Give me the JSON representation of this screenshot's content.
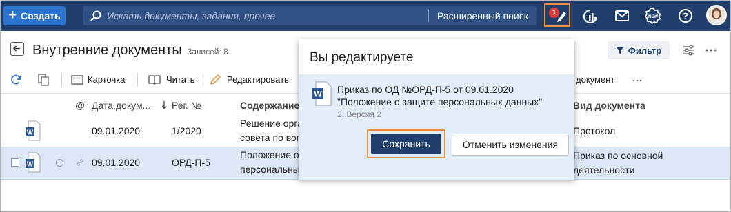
{
  "topbar": {
    "create_label": "Создать",
    "search_placeholder": "Искать документы, задания, прочее",
    "advanced_search": "Расширенный поиск",
    "edit_badge": "1",
    "colors": {
      "bar": "#1f3e6b",
      "accent": "#2b74cf",
      "highlight": "#e8903c",
      "badge": "#e53935"
    }
  },
  "header": {
    "title": "Внутренние документы",
    "count": "Записей: 8",
    "filter_label": "Фильтр"
  },
  "toolbar": {
    "card": "Карточка",
    "read": "Читать",
    "edit": "Редактировать",
    "document": "документ"
  },
  "table": {
    "columns": [
      "@",
      "Дата докум...",
      "Рег. №",
      "Содержание",
      "Вид документа"
    ],
    "rows": [
      {
        "date": "09.01.2020",
        "reg": "1/2020",
        "content_1": "Решение орга",
        "content_2": "совета по воп",
        "kind_1": "Протокол",
        "kind_2": ""
      },
      {
        "date": "09.01.2020",
        "reg": "ОРД-П-5",
        "content_1": "Положение о",
        "content_2": "персональны",
        "kind_1": "Приказ по основной",
        "kind_2": "деятельности"
      }
    ]
  },
  "popup": {
    "title": "Вы редактируете",
    "item_line1": "Приказ по ОД №ОРД-П-5 от 09.01.2020",
    "item_line2": "\"Положение о защите персональных данных\"",
    "item_version": "2. Версия 2",
    "save_label": "Сохранить",
    "cancel_label": "Отменить изменения"
  }
}
